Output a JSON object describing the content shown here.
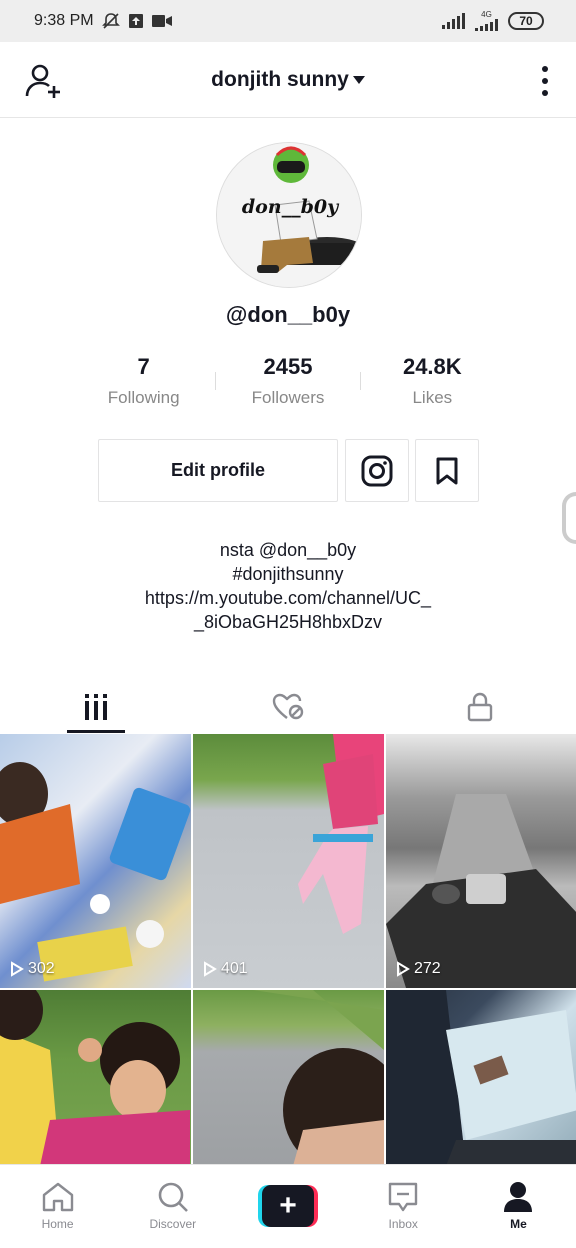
{
  "status_bar": {
    "time": "9:38 PM",
    "network": "4G",
    "battery": "70"
  },
  "header": {
    "title": "donjith sunny"
  },
  "profile": {
    "avatar_text": "don__b0y",
    "username": "@don__b0y",
    "stats": [
      {
        "value": "7",
        "label": "Following"
      },
      {
        "value": "2455",
        "label": "Followers"
      },
      {
        "value": "24.8K",
        "label": "Likes"
      }
    ],
    "edit_label": "Edit profile",
    "bio_lines": [
      "nsta @don__b0y",
      "#donjithsunny",
      "https://m.youtube.com/channel/UC_",
      "_8iObaGH25H8hbxDzv"
    ]
  },
  "videos": [
    {
      "views": "302"
    },
    {
      "views": "401"
    },
    {
      "views": "272"
    },
    {
      "views": ""
    },
    {
      "views": ""
    },
    {
      "views": ""
    }
  ],
  "nav": {
    "home": "Home",
    "discover": "Discover",
    "create": "+",
    "inbox": "Inbox",
    "me": "Me"
  },
  "colors": {
    "text": "#161823",
    "muted": "#888888",
    "accent_cyan": "#20d5ec",
    "accent_pink": "#fe2c55"
  }
}
